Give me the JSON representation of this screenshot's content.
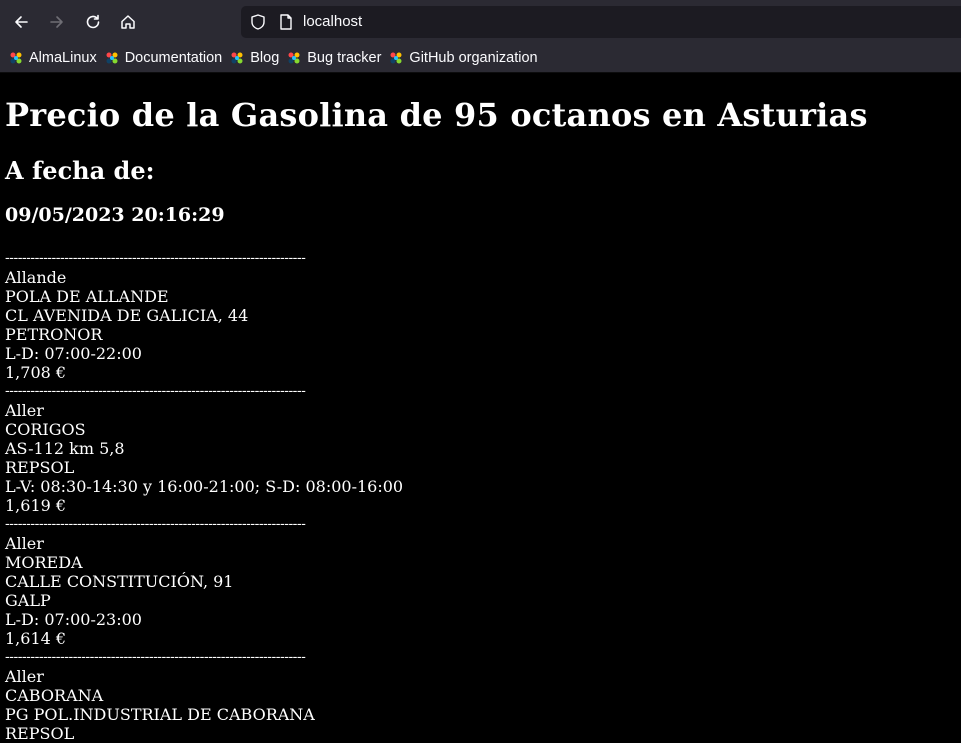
{
  "browser": {
    "url": "localhost",
    "bookmarks": [
      {
        "label": "AlmaLinux",
        "icon": "almalinux-icon"
      },
      {
        "label": "Documentation",
        "icon": "almalinux-icon"
      },
      {
        "label": "Blog",
        "icon": "almalinux-icon"
      },
      {
        "label": "Bug tracker",
        "icon": "almalinux-icon"
      },
      {
        "label": "GitHub organization",
        "icon": "almalinux-icon"
      }
    ]
  },
  "page": {
    "title": "Precio de la Gasolina de 95 octanos en Asturias",
    "date_heading": "A fecha de:",
    "datetime": "09/05/2023 20:16:29",
    "separator": "-----------------------------------------------------------------------",
    "stations": [
      {
        "municipio": "Allande",
        "localidad": "POLA DE ALLANDE",
        "direccion": "CL AVENIDA DE GALICIA, 44",
        "marca": "PETRONOR",
        "horario": "L-D: 07:00-22:00",
        "precio": "1,708 €"
      },
      {
        "municipio": "Aller",
        "localidad": "CORIGOS",
        "direccion": "AS-112 km 5,8",
        "marca": "REPSOL",
        "horario": "L-V: 08:30-14:30 y 16:00-21:00; S-D: 08:00-16:00",
        "precio": "1,619 €"
      },
      {
        "municipio": "Aller",
        "localidad": "MOREDA",
        "direccion": "CALLE CONSTITUCIÓN, 91",
        "marca": "GALP",
        "horario": "L-D: 07:00-23:00",
        "precio": "1,614 €"
      },
      {
        "municipio": "Aller",
        "localidad": "CABORANA",
        "direccion": "PG POL.INDUSTRIAL DE CABORANA",
        "marca": "REPSOL",
        "horario": "",
        "precio": ""
      }
    ]
  }
}
